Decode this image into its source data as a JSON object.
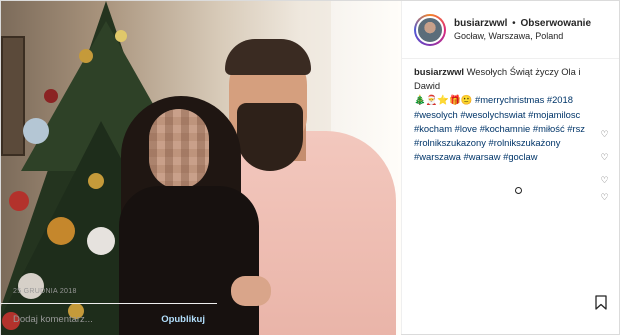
{
  "post": {
    "username": "busiarzwwl",
    "separator": "•",
    "follow_label": "Obserwowanie",
    "location": "Gocław, Warszawa, Poland",
    "caption": {
      "user": "busiarzwwl",
      "text": "Wesołych Świąt życzy Ola i Dawid",
      "emojis": "🎄🎅⭐🎁🙂",
      "tags": [
        "#merrychristmas",
        "#2018",
        "#wesolych",
        "#wesolychswiat",
        "#mojamilosc",
        "#kocham",
        "#love",
        "#kochamnie",
        "#miłość",
        "#rsz",
        "#rolnikszukazony",
        "#rolnikszukażony",
        "#warszawa",
        "#warsaw",
        "#goclaw"
      ]
    },
    "date": "25 GRUDNIA 2018",
    "comment_placeholder": "Dodaj komentarz...",
    "publish_label": "Opublikuj",
    "colors": {
      "link": "#003569",
      "accent": "#3897f0"
    },
    "icons": [
      "heart-icon",
      "heart-icon",
      "heart-icon",
      "heart-icon",
      "bookmark-icon",
      "more-icon"
    ]
  }
}
